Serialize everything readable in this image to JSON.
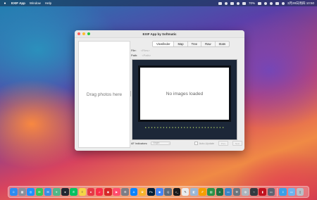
{
  "menubar": {
    "app_name": "EXIF App",
    "items": [
      "Window",
      "Help"
    ],
    "status_text": "70%",
    "clock": "3月28日周四 10:50"
  },
  "window": {
    "title": "EXIF App by Softmatic",
    "dropzone_text": "Drag photos here",
    "tabs": [
      "Viewfinder",
      "Map",
      "Tree",
      "Raw",
      "Stats"
    ],
    "active_tab": "Viewfinder",
    "file_label": "File:",
    "file_value": "<Files>",
    "path_label": "Path:",
    "path_value": "<Path>",
    "viewer_placeholder": "No images loaded",
    "viewfinder_readout": "▶ ▪ ▪ ▪ ▪ ▪  ▪ ▪ ▪ ▪ ▪ ▪ ▪ ▪ ▪ ▪ ▪ ▪ ▪ ▪ ▪ ▪ ▪ ▪ ▪ ▪ ▪",
    "af_label": "AF Indicators:",
    "af_select": "Bright",
    "checkbox_label": "Auto-Update",
    "buttons": [
      "Prev",
      "Next"
    ]
  },
  "colors": {
    "close": "#ff5f57",
    "minimize": "#febc2e",
    "maximize": "#28c840"
  },
  "dock": {
    "icons": [
      {
        "name": "finder-icon",
        "color": "#2d8cf0",
        "glyph": "☺"
      },
      {
        "name": "launchpad-icon",
        "color": "#8a8f9a",
        "glyph": "▦"
      },
      {
        "name": "safari-icon",
        "color": "#1e90ff",
        "glyph": "◎"
      },
      {
        "name": "messages-icon",
        "color": "#34c759",
        "glyph": "✉"
      },
      {
        "name": "mail-icon",
        "color": "#3a8ee6",
        "glyph": "✉"
      },
      {
        "name": "maps-icon",
        "color": "#52b788",
        "glyph": "⌖"
      },
      {
        "name": "penguin-icon",
        "color": "#222831",
        "glyph": "●"
      },
      {
        "name": "wechat-icon",
        "color": "#07c160",
        "glyph": "✆"
      },
      {
        "name": "notes-icon",
        "color": "#f5d547",
        "glyph": "≡"
      },
      {
        "name": "xiaohongshu-icon",
        "color": "#e63946",
        "glyph": "●"
      },
      {
        "name": "music-icon",
        "color": "#fa2d48",
        "glyph": "♫"
      },
      {
        "name": "netease-music-icon",
        "color": "#d62828",
        "glyph": "◉"
      },
      {
        "name": "video-player-icon",
        "color": "#ff4d6d",
        "glyph": "▶"
      },
      {
        "name": "system-settings-icon",
        "color": "#7d7d85",
        "glyph": "⚙"
      },
      {
        "name": "app-store-icon",
        "color": "#0a84ff",
        "glyph": "A"
      },
      {
        "name": "photos-icon",
        "color": "#f7b32b",
        "glyph": "✿"
      },
      {
        "name": "photoshop-icon",
        "color": "#001e36",
        "glyph": "Ps"
      },
      {
        "name": "chrome-icon",
        "color": "#4285f4",
        "glyph": "◉"
      },
      {
        "name": "quicktime-icon",
        "color": "#5c6b7a",
        "glyph": "Q"
      },
      {
        "name": "terminal-icon",
        "color": "#1b1b1b",
        "glyph": ">_"
      },
      {
        "name": "textedit-icon",
        "color": "#e9ecef",
        "glyph": "✎"
      },
      {
        "name": "preview-icon",
        "color": "#9bb7d4",
        "glyph": "◧"
      },
      {
        "name": "pages-icon",
        "color": "#f59f00",
        "glyph": "✐"
      },
      {
        "name": "numbers-icon",
        "color": "#2b9348",
        "glyph": "▤"
      },
      {
        "name": "excel-icon",
        "color": "#1d6f42",
        "glyph": "X"
      },
      {
        "name": "keynote-icon",
        "color": "#3d85c6",
        "glyph": "▭"
      },
      {
        "name": "utility-icon",
        "color": "#6c757d",
        "glyph": "⚒"
      },
      {
        "name": "disk-utility-icon",
        "color": "#adb5bd",
        "glyph": "◍"
      },
      {
        "name": "activity-monitor-icon",
        "color": "#343a40",
        "glyph": "⌁"
      },
      {
        "name": "books-icon",
        "color": "#c1121f",
        "glyph": "▮"
      },
      {
        "name": "display-icon",
        "color": "#5e6472",
        "glyph": "▭"
      },
      {
        "name": "downloads-folder-icon",
        "color": "#3aa0e8",
        "glyph": "⇩"
      },
      {
        "name": "folder-icon",
        "color": "#6cb4ee",
        "glyph": "▭"
      },
      {
        "name": "trash-icon",
        "color": "#b8c0c8",
        "glyph": "▯"
      }
    ]
  }
}
